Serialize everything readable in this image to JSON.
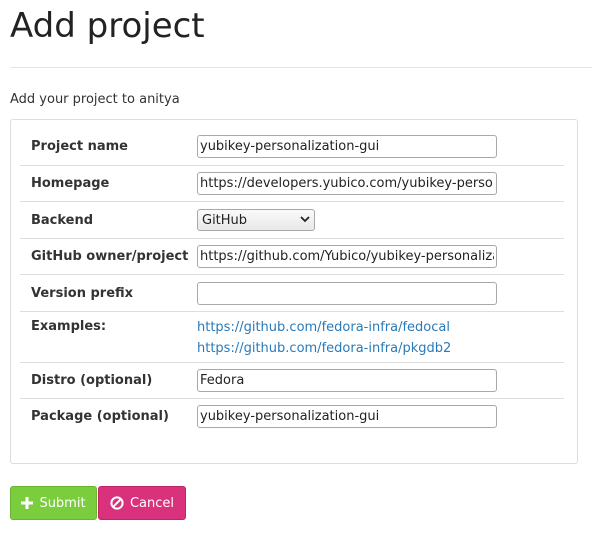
{
  "header": {
    "title": "Add project",
    "subtitle": "Add your project to anitya"
  },
  "form": {
    "project_name": {
      "label": "Project name",
      "value": "yubikey-personalization-gui"
    },
    "homepage": {
      "label": "Homepage",
      "value": "https://developers.yubico.com/yubikey-personalization-gui"
    },
    "backend": {
      "label": "Backend",
      "value": "GitHub"
    },
    "github_project": {
      "label": "GitHub owner/project",
      "value": "https://github.com/Yubico/yubikey-personalization-gui"
    },
    "version_prefix": {
      "label": "Version prefix",
      "value": ""
    },
    "examples": {
      "label": "Examples:",
      "links": [
        "https://github.com/fedora-infra/fedocal",
        "https://github.com/fedora-infra/pkgdb2"
      ]
    },
    "distro": {
      "label": "Distro (optional)",
      "value": "Fedora"
    },
    "package": {
      "label": "Package (optional)",
      "value": "yubikey-personalization-gui"
    }
  },
  "buttons": {
    "submit": {
      "label": "Submit",
      "icon": "plus-icon",
      "color": "#7ace3e"
    },
    "cancel": {
      "label": "Cancel",
      "icon": "ban-icon",
      "color": "#d9317b"
    }
  }
}
